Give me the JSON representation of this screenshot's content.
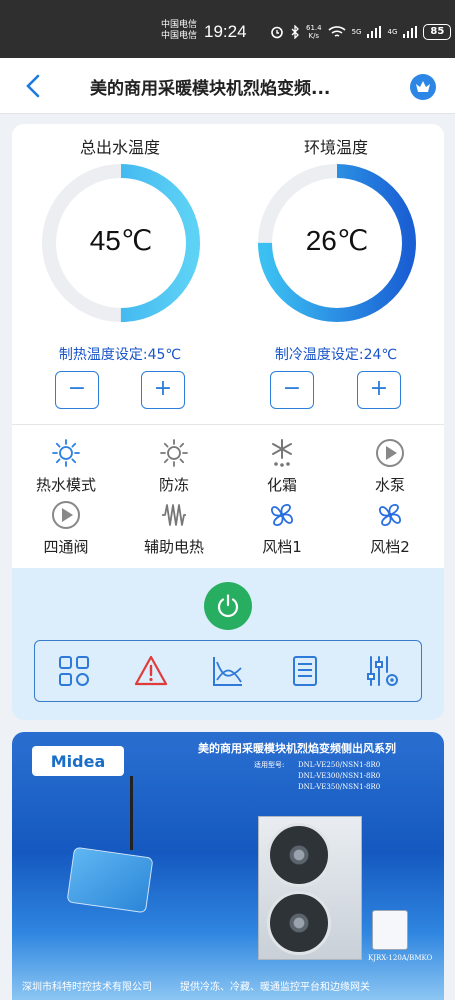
{
  "status_bar": {
    "carrier1": "中国电信",
    "carrier2": "中国电信",
    "time": "19:24",
    "speed": "61.4",
    "speed_unit": "K/s",
    "net1": "5G",
    "net2": "4G",
    "battery": "85"
  },
  "header": {
    "title": "美的商用采暖模块机烈焰变频..."
  },
  "gauges": {
    "outlet": {
      "label": "总出水温度",
      "value": "45℃",
      "fill": 0.5,
      "color": "#3cb6f0"
    },
    "ambient": {
      "label": "环境温度",
      "value": "26℃",
      "fill": 0.75,
      "color": "#1f62d6"
    }
  },
  "setpoints": {
    "heating": "制热温度设定:45℃",
    "cooling": "制冷温度设定:24℃",
    "minus": "−",
    "plus": "+"
  },
  "status_items": [
    {
      "label": "热水模式",
      "icon": "sun-icon"
    },
    {
      "label": "防冻",
      "icon": "sun-icon"
    },
    {
      "label": "化霜",
      "icon": "snowflake-icon"
    },
    {
      "label": "水泵",
      "icon": "play-circle-icon"
    },
    {
      "label": "四通阀",
      "icon": "play-circle-icon"
    },
    {
      "label": "辅助电热",
      "icon": "heater-icon"
    },
    {
      "label": "风档1",
      "icon": "fan-icon"
    },
    {
      "label": "风档2",
      "icon": "fan-icon"
    }
  ],
  "toolbar": {
    "items": [
      "grid-icon",
      "alert-icon",
      "chart-icon",
      "list-icon",
      "settings-icon"
    ]
  },
  "banner": {
    "logo": "Midea",
    "title": "美的商用采暖模块机烈焰变频侧出风系列",
    "model_label": "适用型号:",
    "models": [
      "DNL-VE250/NSN1-8R0",
      "DNL-VE300/NSN1-8R0",
      "DNL-VE350/NSN1-8R0"
    ],
    "thermostat_model": "KJRX-120A/BMKO",
    "footer_company": "深圳市科特时控技术有限公司",
    "footer_slogan": "提供冷冻、冷藏、暖通监控平台和边缘网关"
  }
}
